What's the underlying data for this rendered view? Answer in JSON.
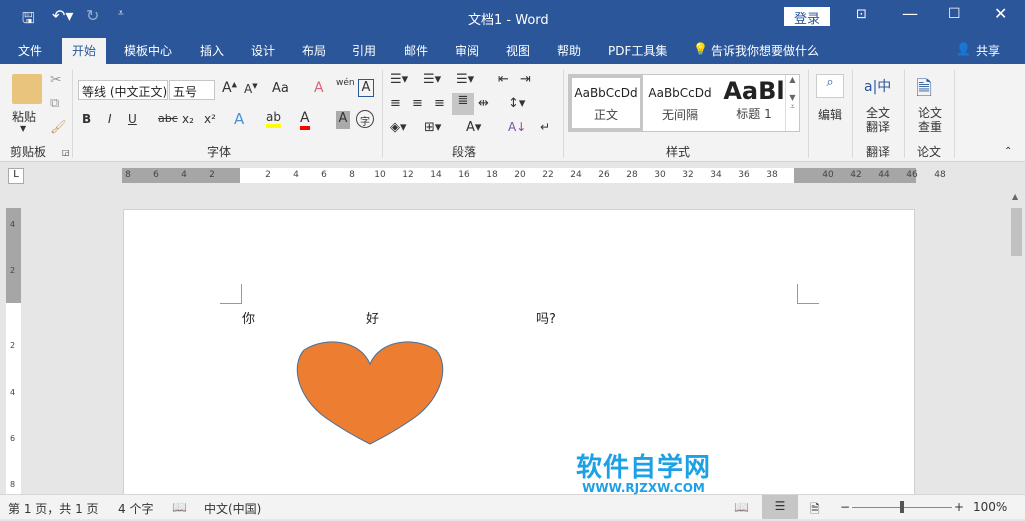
{
  "titlebar": {
    "title": "文档1  -  Word",
    "login": "登录",
    "icons": [
      "save-icon",
      "undo-icon",
      "redo-icon",
      "customize-icon",
      "ribbon-display-icon",
      "minimize-icon",
      "maximize-icon",
      "close-icon"
    ]
  },
  "menu": {
    "items": [
      "文件",
      "开始",
      "模板中心",
      "插入",
      "设计",
      "布局",
      "引用",
      "邮件",
      "审阅",
      "视图",
      "帮助",
      "PDF工具集"
    ],
    "tell_me": "告诉我你想要做什么",
    "share": "共享",
    "active": "开始"
  },
  "ribbon": {
    "clipboard": {
      "paste": "粘贴",
      "label": "剪贴板"
    },
    "font": {
      "font_name": "等线 (中文正文)",
      "font_size": "五号",
      "aa": "Aa",
      "bold": "B",
      "italic": "I",
      "underline": "U",
      "strike": "abc",
      "sub": "x₂",
      "sup": "x²",
      "wen": "wén",
      "char": "字",
      "label": "字体",
      "highlight_color": "#ffff00",
      "font_color": "#ff0000"
    },
    "paragraph": {
      "label": "段落"
    },
    "styles": {
      "items": [
        {
          "preview": "AaBbCcDd",
          "name": "正文"
        },
        {
          "preview": "AaBbCcDd",
          "name": "无间隔"
        },
        {
          "preview": "AaBl",
          "name": "标题 1"
        }
      ],
      "label": "样式"
    },
    "edit": {
      "label": "编辑"
    },
    "translate": {
      "button": "全文翻译",
      "label": "翻译"
    },
    "paper": {
      "button": "论文查重",
      "label": "论文"
    }
  },
  "ruler": {
    "left_ticks": [
      "8",
      "6",
      "4",
      "2"
    ],
    "ticks": [
      "2",
      "4",
      "6",
      "8",
      "10",
      "12",
      "14",
      "16",
      "18",
      "20",
      "22",
      "24",
      "26",
      "28",
      "30",
      "32",
      "34",
      "36",
      "38"
    ],
    "right_ticks": [
      "40",
      "42",
      "44",
      "46",
      "48"
    ],
    "vertical_ticks": [
      "4",
      "2",
      "2",
      "4",
      "6",
      "8"
    ]
  },
  "document": {
    "text": [
      "你",
      "好",
      "吗?"
    ],
    "shape": "heart",
    "shape_fill": "#ed7d31",
    "shape_stroke": "#41719c"
  },
  "watermark": {
    "title": "软件自学网",
    "url": "WWW.RJZXW.COM"
  },
  "statusbar": {
    "page": "第 1 页，共 1 页",
    "words": "4 个字",
    "language": "中文(中国)",
    "zoom": "100%",
    "zoom_level": 100
  }
}
